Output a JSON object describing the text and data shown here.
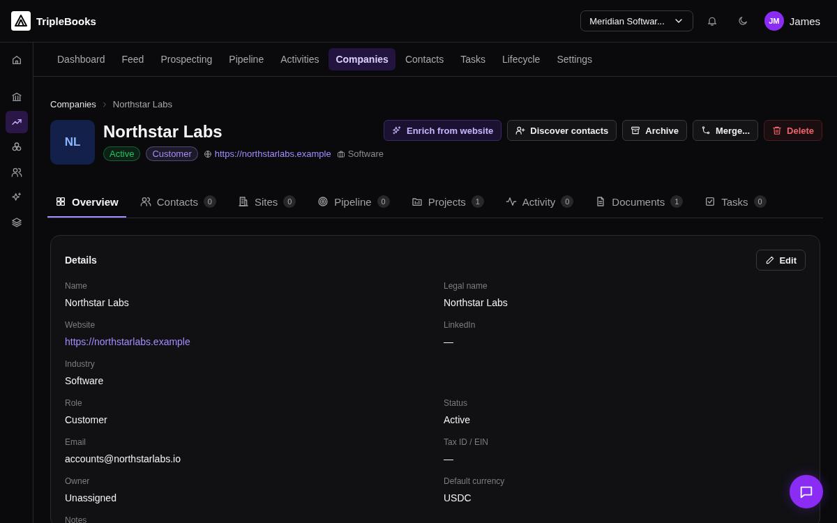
{
  "app": {
    "name": "TripleBooks"
  },
  "header": {
    "workspace": "Meridian Softwar...",
    "user": {
      "initials": "JM",
      "name": "James"
    }
  },
  "sidebar": {
    "items": [
      {
        "kind": "home",
        "selected": false
      },
      {
        "kind": "bank",
        "selected": false
      },
      {
        "kind": "trend",
        "selected": true
      },
      {
        "kind": "boxes",
        "selected": false
      },
      {
        "kind": "users",
        "selected": false
      },
      {
        "kind": "sparkles",
        "selected": false
      },
      {
        "kind": "layers",
        "selected": false
      }
    ]
  },
  "nav": [
    {
      "label": "Dashboard",
      "selected": false
    },
    {
      "label": "Feed",
      "selected": false
    },
    {
      "label": "Prospecting",
      "selected": false
    },
    {
      "label": "Pipeline",
      "selected": false
    },
    {
      "label": "Activities",
      "selected": false
    },
    {
      "label": "Companies",
      "selected": true
    },
    {
      "label": "Contacts",
      "selected": false
    },
    {
      "label": "Tasks",
      "selected": false
    },
    {
      "label": "Lifecycle",
      "selected": false
    },
    {
      "label": "Settings",
      "selected": false
    }
  ],
  "breadcrumb": [
    "Companies",
    "Northstar Labs"
  ],
  "company": {
    "initials": "NL",
    "name": "Northstar Labs",
    "badges": [
      {
        "label": "Active",
        "color": "#22c55e"
      },
      {
        "label": "Customer",
        "color": "#a78bfa"
      }
    ],
    "website": "https://northstarlabs.example",
    "industry": "Software"
  },
  "actions": [
    {
      "label": "Enrich from website",
      "kind": "accent"
    },
    {
      "label": "Discover contacts",
      "kind": "discover"
    },
    {
      "label": "Archive",
      "kind": "archive"
    },
    {
      "label": "Merge...",
      "kind": "merge"
    },
    {
      "label": "Delete",
      "kind": "danger"
    }
  ],
  "tabs": [
    {
      "label": "Overview",
      "kind": "grid",
      "selected": true
    },
    {
      "label": "Contacts",
      "kind": "users",
      "count": "0",
      "selected": false
    },
    {
      "label": "Sites",
      "kind": "building",
      "count": "0",
      "selected": false
    },
    {
      "label": "Pipeline",
      "kind": "target",
      "count": "0",
      "selected": false
    },
    {
      "label": "Projects",
      "kind": "folder",
      "count": "1",
      "selected": false
    },
    {
      "label": "Activity",
      "kind": "pulse",
      "count": "0",
      "selected": false
    },
    {
      "label": "Documents",
      "kind": "doc",
      "count": "1",
      "selected": false
    },
    {
      "label": "Tasks",
      "kind": "check",
      "count": "0",
      "selected": false
    }
  ],
  "details": {
    "title": "Details",
    "edit_button": "Edit",
    "rows": [
      {
        "left": {
          "label": "Name",
          "value": "Northstar Labs"
        },
        "right": {
          "label": "Legal name",
          "value": "Northstar Labs"
        }
      },
      {
        "left": {
          "label": "Website",
          "value": "https://northstarlabs.example",
          "kind": "link"
        },
        "right": {
          "label": "LinkedIn",
          "value": "—"
        }
      },
      {
        "left": {
          "label": "Industry",
          "value": "Software"
        }
      },
      {
        "left": {
          "label": "Role",
          "value": "Customer"
        },
        "right": {
          "label": "Status",
          "value": "Active"
        }
      },
      {
        "left": {
          "label": "Email",
          "value": "accounts@northstarlabs.io"
        },
        "right": {
          "label": "Tax ID / EIN",
          "value": "—"
        }
      },
      {
        "left": {
          "label": "Owner",
          "value": "Unassigned"
        },
        "right": {
          "label": "Default currency",
          "value": "USDC"
        }
      },
      {
        "left": {
          "label": "Notes"
        }
      }
    ]
  }
}
